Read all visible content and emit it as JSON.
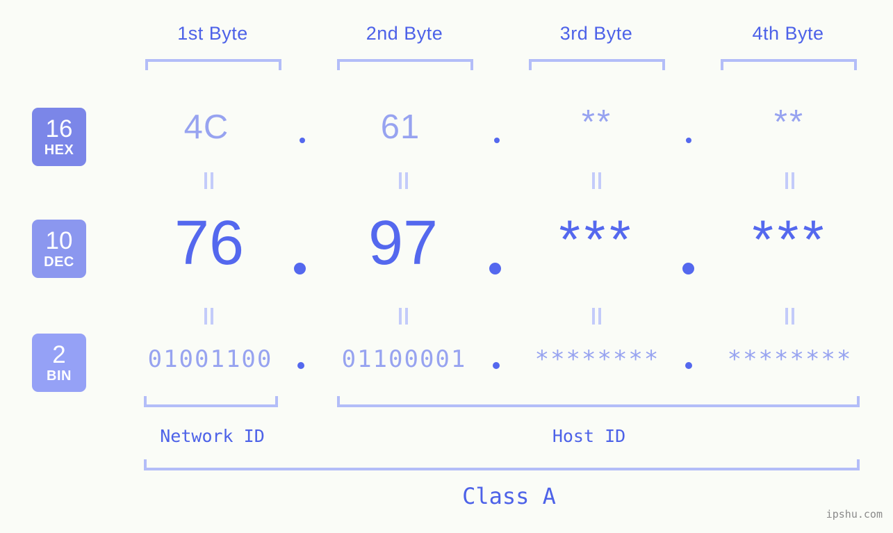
{
  "watermark": "ipshu.com",
  "byte_headers": [
    {
      "label": "1st Byte"
    },
    {
      "label": "2nd Byte"
    },
    {
      "label": "3rd Byte"
    },
    {
      "label": "4th Byte"
    }
  ],
  "radix_badges": [
    {
      "number": "16",
      "name": "HEX",
      "color": "#7b86e8"
    },
    {
      "number": "10",
      "name": "DEC",
      "color": "#8b97ef"
    },
    {
      "number": "2",
      "name": "BIN",
      "color": "#95a1f6"
    }
  ],
  "rows": {
    "hex": {
      "values": [
        "4C",
        "61",
        "**",
        "**"
      ]
    },
    "dec": {
      "values": [
        "76",
        "97",
        "***",
        "***"
      ]
    },
    "bin": {
      "values": [
        "01001100",
        "01100001",
        "********",
        "********"
      ]
    }
  },
  "separators": {
    "dot": ".",
    "equals": "||"
  },
  "segments": [
    {
      "label": "Network ID"
    },
    {
      "label": "Host ID"
    }
  ],
  "class": {
    "label": "Class A"
  },
  "colors": {
    "background": "#fafcf7",
    "accent_strong": "#4d62e8",
    "accent_mid": "#5468ee",
    "accent_light": "#97a3f0",
    "bracket": "#b3bdf8",
    "equals": "#c3cbfa",
    "watermark": "#8a8a8a"
  }
}
